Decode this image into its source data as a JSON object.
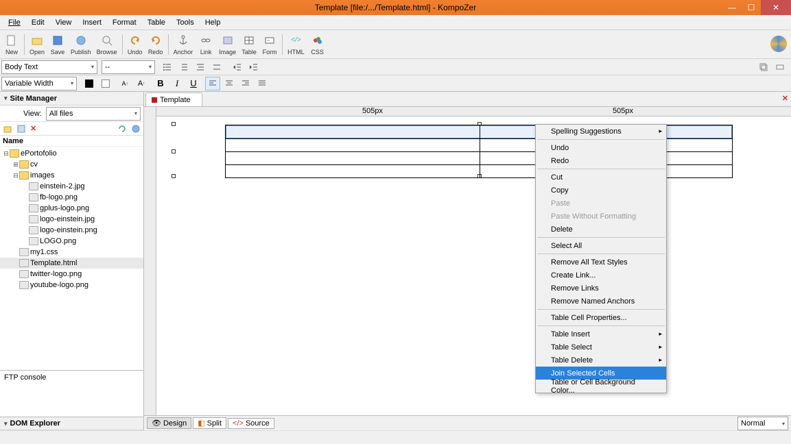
{
  "title": "Template [file:/.../Template.html] - KompoZer",
  "winbtns": {
    "min": "—",
    "max": "☐",
    "close": "✕"
  },
  "menu": [
    "File",
    "Edit",
    "View",
    "Insert",
    "Format",
    "Table",
    "Tools",
    "Help"
  ],
  "tb1": [
    {
      "ic": "new",
      "lb": "New"
    },
    {
      "ic": "open",
      "lb": "Open"
    },
    {
      "ic": "save",
      "lb": "Save"
    },
    {
      "ic": "publish",
      "lb": "Publish"
    },
    {
      "ic": "browse",
      "lb": "Browse"
    },
    {
      "ic": "undo",
      "lb": "Undo"
    },
    {
      "ic": "redo",
      "lb": "Redo"
    },
    {
      "ic": "anchor",
      "lb": "Anchor"
    },
    {
      "ic": "link",
      "lb": "Link"
    },
    {
      "ic": "image",
      "lb": "Image"
    },
    {
      "ic": "table",
      "lb": "Table"
    },
    {
      "ic": "form",
      "lb": "Form"
    },
    {
      "ic": "html",
      "lb": "HTML"
    },
    {
      "ic": "css",
      "lb": "CSS"
    }
  ],
  "para_sel": "Body Text",
  "style_sel": "--",
  "font_sel": "Variable Width",
  "sidebar": {
    "title": "Site Manager",
    "view_lbl": "View:",
    "view_sel": "All files",
    "name_hdr": "Name",
    "tree": [
      {
        "d": 0,
        "t": "ePortofolio",
        "twist": "⊟",
        "ic": "folder"
      },
      {
        "d": 1,
        "t": "cv",
        "twist": "⊞",
        "ic": "folder"
      },
      {
        "d": 1,
        "t": "images",
        "twist": "⊟",
        "ic": "folder"
      },
      {
        "d": 2,
        "t": "einstein-2.jpg",
        "ic": "file"
      },
      {
        "d": 2,
        "t": "fb-logo.png",
        "ic": "file"
      },
      {
        "d": 2,
        "t": "gplus-logo.png",
        "ic": "file"
      },
      {
        "d": 2,
        "t": "logo-einstein.jpg",
        "ic": "file"
      },
      {
        "d": 2,
        "t": "logo-einstein.png",
        "ic": "file"
      },
      {
        "d": 2,
        "t": "LOGO.png",
        "ic": "file"
      },
      {
        "d": 1,
        "t": "my1.css",
        "ic": "file"
      },
      {
        "d": 1,
        "t": "Template.html",
        "ic": "file",
        "sel": true
      },
      {
        "d": 1,
        "t": "twitter-logo.png",
        "ic": "file"
      },
      {
        "d": 1,
        "t": "youtube-logo.png",
        "ic": "file"
      }
    ],
    "ftp": "FTP console",
    "dom": "DOM Explorer"
  },
  "doc_tab": "Template",
  "ruler": {
    "t1": "505px",
    "t2": "505px"
  },
  "ctx": [
    {
      "t": "Spelling Suggestions",
      "sub": true
    },
    {
      "sep": true
    },
    {
      "t": "Undo"
    },
    {
      "t": "Redo"
    },
    {
      "sep": true
    },
    {
      "t": "Cut"
    },
    {
      "t": "Copy"
    },
    {
      "t": "Paste",
      "dis": true
    },
    {
      "t": "Paste Without Formatting",
      "dis": true
    },
    {
      "t": "Delete"
    },
    {
      "sep": true
    },
    {
      "t": "Select All"
    },
    {
      "sep": true
    },
    {
      "t": "Remove All Text Styles"
    },
    {
      "t": "Create Link..."
    },
    {
      "t": "Remove Links"
    },
    {
      "t": "Remove Named Anchors"
    },
    {
      "sep": true
    },
    {
      "t": "Table Cell Properties..."
    },
    {
      "sep": true
    },
    {
      "t": "Table Insert",
      "sub": true
    },
    {
      "t": "Table Select",
      "sub": true
    },
    {
      "t": "Table Delete",
      "sub": true
    },
    {
      "t": "Join Selected Cells",
      "hl": true
    },
    {
      "t": "Table or Cell Background Color..."
    }
  ],
  "viewtabs": {
    "design": "Design",
    "split": "Split",
    "source": "Source"
  },
  "zoom_sel": "Normal"
}
